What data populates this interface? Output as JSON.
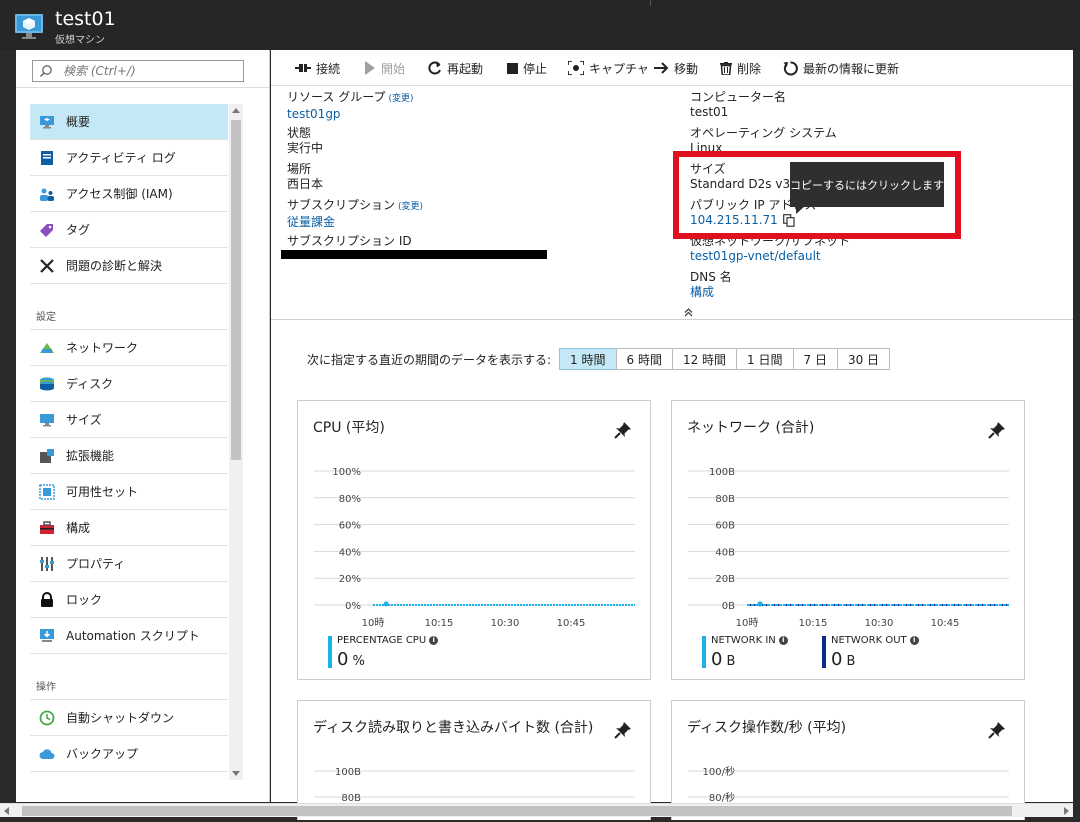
{
  "titlebar": {
    "title": "test01",
    "subtitle": "仮想マシン"
  },
  "search": {
    "placeholder": "検索 (Ctrl+/)"
  },
  "sidebar": {
    "items": [
      {
        "label": "概要",
        "icon": "monitor-icon"
      },
      {
        "label": "アクティビティ ログ",
        "icon": "log-icon"
      },
      {
        "label": "アクセス制御 (IAM)",
        "icon": "users-icon"
      },
      {
        "label": "タグ",
        "icon": "tag-icon"
      },
      {
        "label": "問題の診断と解決",
        "icon": "wrench-icon"
      }
    ],
    "section_settings": "設定",
    "settings_items": [
      {
        "label": "ネットワーク",
        "icon": "network-icon"
      },
      {
        "label": "ディスク",
        "icon": "disk-icon"
      },
      {
        "label": "サイズ",
        "icon": "size-icon"
      },
      {
        "label": "拡張機能",
        "icon": "extension-icon"
      },
      {
        "label": "可用性セット",
        "icon": "availability-set-icon"
      },
      {
        "label": "構成",
        "icon": "toolbox-icon"
      },
      {
        "label": "プロパティ",
        "icon": "properties-icon"
      },
      {
        "label": "ロック",
        "icon": "lock-icon"
      },
      {
        "label": "Automation スクリプト",
        "icon": "automation-icon"
      }
    ],
    "section_operations": "操作",
    "operations_items": [
      {
        "label": "自動シャットダウン",
        "icon": "clock-icon"
      },
      {
        "label": "バックアップ",
        "icon": "cloud-icon"
      }
    ]
  },
  "toolbar": {
    "connect": "接続",
    "start": "開始",
    "restart": "再起動",
    "stop": "停止",
    "capture": "キャプチャ",
    "move": "移動",
    "delete": "削除",
    "refresh": "最新の情報に更新"
  },
  "essentials": {
    "resource_group_label": "リソース グループ",
    "change": "(変更)",
    "resource_group_value": "test01gp",
    "status_label": "状態",
    "status_value": "実行中",
    "location_label": "場所",
    "location_value": "西日本",
    "subscription_label": "サブスクリプション",
    "subscription_value": "従量課金",
    "subscription_id_label": "サブスクリプション ID",
    "computer_name_label": "コンピューター名",
    "computer_name_value": "test01",
    "os_label": "オペレーティング システム",
    "os_value": "Linux",
    "size_label": "サイズ",
    "size_value": "Standard D2s v3",
    "public_ip_label": "パブリック IP アドレス",
    "public_ip_value": "104.215.11.71",
    "vnet_label": "仮想ネットワーク/サブネット",
    "vnet_value": "test01gp-vnet/default",
    "dns_label": "DNS 名",
    "dns_value": "構成"
  },
  "tooltip": {
    "text": "コピーするにはクリックします"
  },
  "timerange": {
    "label": "次に指定する直近の期間のデータを表示する:",
    "options": [
      "1 時間",
      "6 時間",
      "12 時間",
      "1 日間",
      "7 日",
      "30 日"
    ],
    "selected": "1 時間"
  },
  "cards": {
    "cpu": {
      "title": "CPU (平均)",
      "yticks": [
        "100%",
        "80%",
        "60%",
        "40%",
        "20%",
        "0%"
      ],
      "xticks": [
        "10時",
        "10:15",
        "10:30",
        "10:45"
      ],
      "legend_name": "PERCENTAGE CPU",
      "legend_value": "0",
      "legend_unit": "%",
      "color": "#19b3ea"
    },
    "network": {
      "title": "ネットワーク (合計)",
      "yticks": [
        "100B",
        "80B",
        "60B",
        "40B",
        "20B",
        "0B"
      ],
      "xticks": [
        "10時",
        "10:15",
        "10:30",
        "10:45"
      ],
      "in_name": "NETWORK IN",
      "in_value": "0",
      "in_unit": "B",
      "in_color": "#19b3ea",
      "out_name": "NETWORK OUT",
      "out_value": "0",
      "out_unit": "B",
      "out_color": "#0c2b8c"
    },
    "disk_bytes": {
      "title": "ディスク読み取りと書き込みバイト数 (合計)",
      "yticks": [
        "100B",
        "80B"
      ]
    },
    "disk_ops": {
      "title": "ディスク操作数/秒 (平均)",
      "yticks": [
        "100/秒",
        "80/秒"
      ]
    }
  },
  "chart_data": [
    {
      "type": "line",
      "title": "CPU (平均)",
      "x": [
        "10時",
        "10:15",
        "10:30",
        "10:45"
      ],
      "series": [
        {
          "name": "PERCENTAGE CPU",
          "values": [
            0,
            0,
            0,
            0
          ]
        }
      ],
      "ylim": [
        0,
        100
      ]
    },
    {
      "type": "line",
      "title": "ネットワーク (合計)",
      "x": [
        "10時",
        "10:15",
        "10:30",
        "10:45"
      ],
      "series": [
        {
          "name": "NETWORK IN",
          "values": [
            0,
            0,
            0,
            0
          ]
        },
        {
          "name": "NETWORK OUT",
          "values": [
            0,
            0,
            0,
            0
          ]
        }
      ],
      "ylim": [
        0,
        100
      ]
    }
  ]
}
